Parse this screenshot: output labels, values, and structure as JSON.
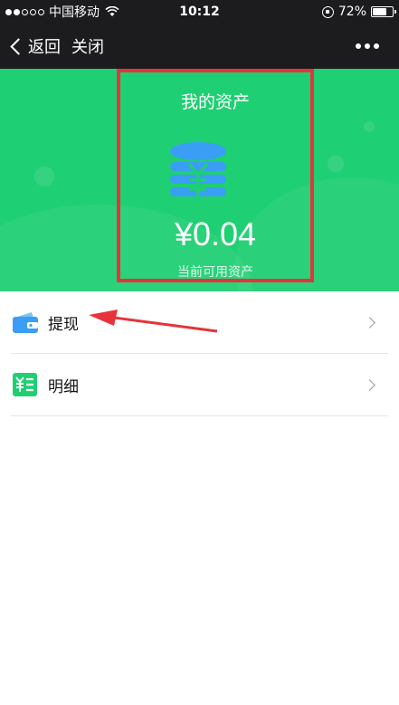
{
  "status_bar": {
    "carrier": "中国移动",
    "time": "10:12",
    "battery": "72%",
    "battery_level": 0.72
  },
  "nav": {
    "back_label": "返回",
    "close_label": "关闭"
  },
  "asset": {
    "title": "我的资产",
    "amount": "¥0.04",
    "subtitle": "当前可用资产"
  },
  "menu": {
    "items": [
      {
        "label": "提现",
        "icon": "wallet-icon"
      },
      {
        "label": "明细",
        "icon": "ledger-icon"
      }
    ]
  },
  "colors": {
    "banner": "#1fcf73",
    "annotation": "#e6343a",
    "coin": "#3a9ef5"
  }
}
